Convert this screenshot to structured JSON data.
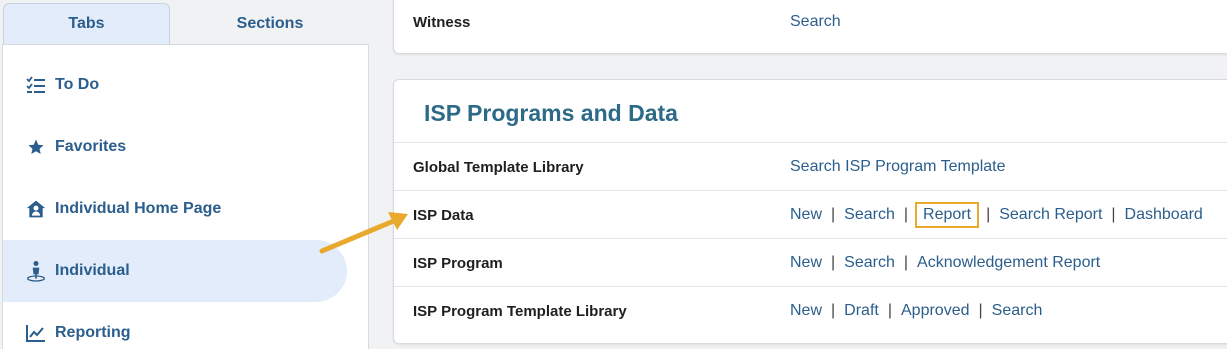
{
  "tabs": {
    "active": "Tabs",
    "inactive": "Sections"
  },
  "sidebar": {
    "items": [
      {
        "label": "To Do",
        "icon": "checklist-icon"
      },
      {
        "label": "Favorites",
        "icon": "star-icon"
      },
      {
        "label": "Individual Home Page",
        "icon": "house-person-icon"
      },
      {
        "label": "Individual",
        "icon": "person-icon"
      },
      {
        "label": "Reporting",
        "icon": "chart-line-icon"
      }
    ]
  },
  "top_card": {
    "label": "Witness",
    "links": [
      "Search"
    ]
  },
  "main_card": {
    "title": "ISP Programs and Data",
    "rows": [
      {
        "label": "Global Template Library",
        "links": [
          "Search ISP Program Template"
        ]
      },
      {
        "label": "ISP Data",
        "links": [
          "New",
          "Search",
          "Report",
          "Search Report",
          "Dashboard"
        ]
      },
      {
        "label": "ISP Program",
        "links": [
          "New",
          "Search",
          "Acknowledgement Report"
        ]
      },
      {
        "label": "ISP Program Template Library",
        "links": [
          "New",
          "Draft",
          "Approved",
          "Search"
        ]
      }
    ]
  },
  "separator": "|",
  "colors": {
    "accent": "#2b5e8c",
    "highlight": "#e8a92c",
    "active_bg": "#e3ecfa"
  }
}
